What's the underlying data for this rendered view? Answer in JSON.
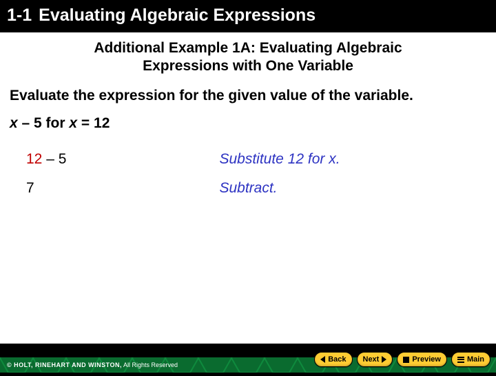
{
  "header": {
    "section": "1-1",
    "title": "Evaluating Algebraic Expressions"
  },
  "example": {
    "title_line1": "Additional Example 1A: Evaluating Algebraic",
    "title_line2": "Expressions with One Variable",
    "instruction": "Evaluate the expression for the given value of the variable.",
    "problem_prefix": "x",
    "problem_mid": " – 5 for ",
    "problem_var": "x",
    "problem_suffix": " = 12"
  },
  "steps": [
    {
      "left_red": "12",
      "left_rest": " – 5",
      "right": "Substitute 12 for x."
    },
    {
      "left_red": "",
      "left_rest": "  7",
      "right": "Subtract."
    }
  ],
  "footer": {
    "copyright_bold": "© HOLT, RINEHART AND WINSTON,",
    "copyright_rest": " All Rights Reserved"
  },
  "nav": {
    "back": "Back",
    "next": "Next",
    "preview": "Preview",
    "main": "Main"
  }
}
